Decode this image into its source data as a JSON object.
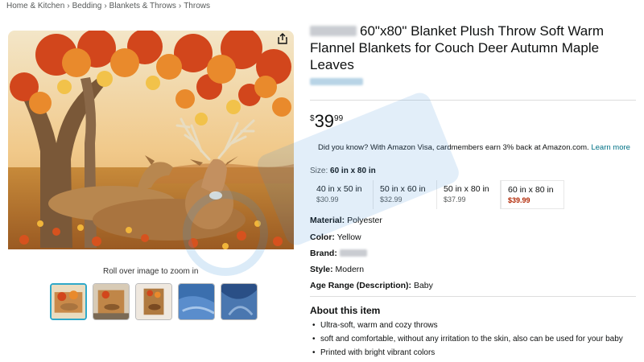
{
  "breadcrumb": [
    "Home & Kitchen",
    "Bedding",
    "Blankets & Throws",
    "Throws"
  ],
  "breadcrumb_sep": "›",
  "product": {
    "title": "60\"x80\" Blanket Plush Throw Soft Warm Flannel Blankets for Couch Deer Autumn Maple Leaves",
    "price": {
      "symbol": "$",
      "whole": "39",
      "fraction": "99"
    },
    "promo": {
      "text": "Did you know? With Amazon Visa, cardmembers earn 3% back at Amazon.com.",
      "link": "Learn more"
    },
    "size": {
      "label": "Size:",
      "selected": "60 in x 80 in",
      "options": [
        {
          "name": "40 in x 50 in",
          "price": "$30.99"
        },
        {
          "name": "50 in x 60 in",
          "price": "$32.99"
        },
        {
          "name": "50 in x 80 in",
          "price": "$37.99"
        },
        {
          "name": "60 in x 80 in",
          "price": "$39.99"
        }
      ]
    },
    "specs": {
      "material_key": "Material:",
      "material_val": "Polyester",
      "color_key": "Color:",
      "color_val": "Yellow",
      "brand_key": "Brand:",
      "style_key": "Style:",
      "style_val": "Modern",
      "age_key": "Age Range (Description):",
      "age_val": "Baby"
    },
    "about": {
      "heading": "About this item",
      "bullets": [
        "Ultra-soft, warm and cozy throws",
        "soft and comfortable, without any irritation to the skin, also can be used for your baby",
        "Printed with bright vibrant colors"
      ]
    }
  },
  "gallery": {
    "zoom_hint": "Roll over image to zoom in",
    "thumbnails": [
      "deer-blanket",
      "blanket-on-couch",
      "blanket-on-chair",
      "blue-flannel-closeup",
      "denim-blue-fabric"
    ]
  },
  "icons": {
    "share": "share-icon"
  },
  "colors": {
    "link": "#007185",
    "deal": "#b12704",
    "thumb_selected": "#2fa8c9"
  }
}
